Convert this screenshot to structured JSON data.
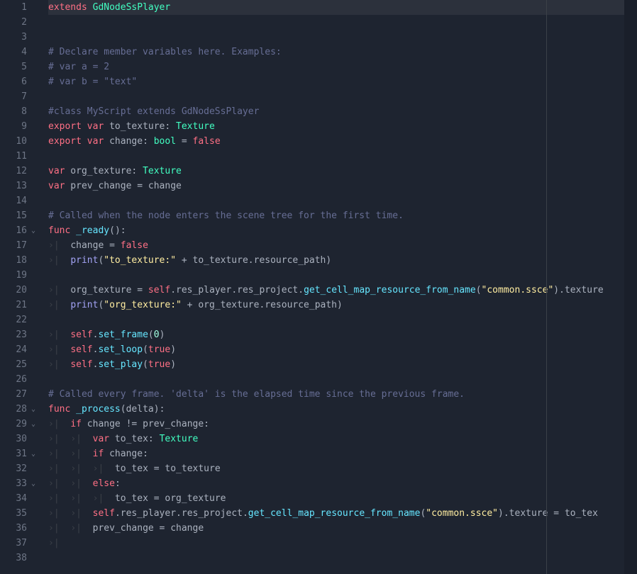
{
  "lines": [
    {
      "n": 1,
      "fold": "",
      "tokens": [
        [
          "keyword",
          "extends"
        ],
        [
          "ident",
          " "
        ],
        [
          "type",
          "GdNodeSsPlayer"
        ]
      ]
    },
    {
      "n": 2,
      "fold": "",
      "tokens": []
    },
    {
      "n": 3,
      "fold": "",
      "tokens": []
    },
    {
      "n": 4,
      "fold": "",
      "tokens": [
        [
          "comment",
          "# Declare member variables here. Examples:"
        ]
      ]
    },
    {
      "n": 5,
      "fold": "",
      "tokens": [
        [
          "comment",
          "# var a = 2"
        ]
      ]
    },
    {
      "n": 6,
      "fold": "",
      "tokens": [
        [
          "comment",
          "# var b = \"text\""
        ]
      ]
    },
    {
      "n": 7,
      "fold": "",
      "tokens": []
    },
    {
      "n": 8,
      "fold": "",
      "tokens": [
        [
          "comment",
          "#class MyScript extends GdNodeSsPlayer"
        ]
      ]
    },
    {
      "n": 9,
      "fold": "",
      "tokens": [
        [
          "keyword",
          "export"
        ],
        [
          "ident",
          " "
        ],
        [
          "keyword",
          "var"
        ],
        [
          "ident",
          " to_texture"
        ],
        [
          "punct",
          ": "
        ],
        [
          "type",
          "Texture"
        ]
      ]
    },
    {
      "n": 10,
      "fold": "",
      "tokens": [
        [
          "keyword",
          "export"
        ],
        [
          "ident",
          " "
        ],
        [
          "keyword",
          "var"
        ],
        [
          "ident",
          " change"
        ],
        [
          "punct",
          ": "
        ],
        [
          "type",
          "bool"
        ],
        [
          "punct",
          " = "
        ],
        [
          "bool",
          "false"
        ]
      ]
    },
    {
      "n": 11,
      "fold": "",
      "tokens": []
    },
    {
      "n": 12,
      "fold": "",
      "tokens": [
        [
          "keyword",
          "var"
        ],
        [
          "ident",
          " org_texture"
        ],
        [
          "punct",
          ": "
        ],
        [
          "type",
          "Texture"
        ]
      ]
    },
    {
      "n": 13,
      "fold": "",
      "tokens": [
        [
          "keyword",
          "var"
        ],
        [
          "ident",
          " prev_change "
        ],
        [
          "punct",
          "="
        ],
        [
          "ident",
          " change"
        ]
      ]
    },
    {
      "n": 14,
      "fold": "",
      "tokens": []
    },
    {
      "n": 15,
      "fold": "",
      "tokens": [
        [
          "comment",
          "# Called when the node enters the scene tree for the first time."
        ]
      ]
    },
    {
      "n": 16,
      "fold": "v",
      "tokens": [
        [
          "keyword",
          "func"
        ],
        [
          "ident",
          " "
        ],
        [
          "funcname",
          "_ready"
        ],
        [
          "punct",
          "("
        ],
        [
          "punct",
          ")"
        ],
        [
          "punct",
          ":"
        ]
      ]
    },
    {
      "n": 17,
      "fold": "",
      "indent": 1,
      "tokens": [
        [
          "ident",
          "change "
        ],
        [
          "punct",
          "="
        ],
        [
          "ident",
          " "
        ],
        [
          "bool",
          "false"
        ]
      ]
    },
    {
      "n": 18,
      "fold": "",
      "indent": 1,
      "tokens": [
        [
          "func",
          "print"
        ],
        [
          "punct",
          "("
        ],
        [
          "string",
          "\"to_texture:\""
        ],
        [
          "punct",
          " + "
        ],
        [
          "ident",
          "to_texture"
        ],
        [
          "punct",
          "."
        ],
        [
          "ident",
          "resource_path"
        ],
        [
          "punct",
          ")"
        ]
      ]
    },
    {
      "n": 19,
      "fold": "",
      "tokens": []
    },
    {
      "n": 20,
      "fold": "",
      "indent": 1,
      "tokens": [
        [
          "ident",
          "org_texture "
        ],
        [
          "punct",
          "="
        ],
        [
          "ident",
          " "
        ],
        [
          "keyword",
          "self"
        ],
        [
          "punct",
          "."
        ],
        [
          "ident",
          "res_player"
        ],
        [
          "punct",
          "."
        ],
        [
          "ident",
          "res_project"
        ],
        [
          "punct",
          "."
        ],
        [
          "method",
          "get_cell_map_resource_from_name"
        ],
        [
          "punct",
          "("
        ],
        [
          "string",
          "\"common.ssce\""
        ],
        [
          "punct",
          ")"
        ],
        [
          "punct",
          "."
        ],
        [
          "ident",
          "texture"
        ]
      ]
    },
    {
      "n": 21,
      "fold": "",
      "indent": 1,
      "tokens": [
        [
          "func",
          "print"
        ],
        [
          "punct",
          "("
        ],
        [
          "string",
          "\"org_texture:\""
        ],
        [
          "punct",
          " + "
        ],
        [
          "ident",
          "org_texture"
        ],
        [
          "punct",
          "."
        ],
        [
          "ident",
          "resource_path"
        ],
        [
          "punct",
          ")"
        ]
      ]
    },
    {
      "n": 22,
      "fold": "",
      "tokens": []
    },
    {
      "n": 23,
      "fold": "",
      "indent": 1,
      "tokens": [
        [
          "keyword",
          "self"
        ],
        [
          "punct",
          "."
        ],
        [
          "method",
          "set_frame"
        ],
        [
          "punct",
          "("
        ],
        [
          "number",
          "0"
        ],
        [
          "punct",
          ")"
        ]
      ]
    },
    {
      "n": 24,
      "fold": "",
      "indent": 1,
      "tokens": [
        [
          "keyword",
          "self"
        ],
        [
          "punct",
          "."
        ],
        [
          "method",
          "set_loop"
        ],
        [
          "punct",
          "("
        ],
        [
          "bool",
          "true"
        ],
        [
          "punct",
          ")"
        ]
      ]
    },
    {
      "n": 25,
      "fold": "",
      "indent": 1,
      "tokens": [
        [
          "keyword",
          "self"
        ],
        [
          "punct",
          "."
        ],
        [
          "method",
          "set_play"
        ],
        [
          "punct",
          "("
        ],
        [
          "bool",
          "true"
        ],
        [
          "punct",
          ")"
        ]
      ]
    },
    {
      "n": 26,
      "fold": "",
      "tokens": []
    },
    {
      "n": 27,
      "fold": "",
      "tokens": [
        [
          "comment",
          "# Called every frame. 'delta' is the elapsed time since the previous frame."
        ]
      ]
    },
    {
      "n": 28,
      "fold": "v",
      "tokens": [
        [
          "keyword",
          "func"
        ],
        [
          "ident",
          " "
        ],
        [
          "funcname",
          "_process"
        ],
        [
          "punct",
          "("
        ],
        [
          "ident",
          "delta"
        ],
        [
          "punct",
          ")"
        ],
        [
          "punct",
          ":"
        ]
      ]
    },
    {
      "n": 29,
      "fold": "v",
      "indent": 1,
      "tokens": [
        [
          "keyword",
          "if"
        ],
        [
          "ident",
          " change "
        ],
        [
          "punct",
          "!="
        ],
        [
          "ident",
          " prev_change"
        ],
        [
          "punct",
          ":"
        ]
      ]
    },
    {
      "n": 30,
      "fold": "",
      "indent": 2,
      "tokens": [
        [
          "keyword",
          "var"
        ],
        [
          "ident",
          " to_tex"
        ],
        [
          "punct",
          ": "
        ],
        [
          "type",
          "Texture"
        ]
      ]
    },
    {
      "n": 31,
      "fold": "v",
      "indent": 2,
      "tokens": [
        [
          "keyword",
          "if"
        ],
        [
          "ident",
          " change"
        ],
        [
          "punct",
          ":"
        ]
      ]
    },
    {
      "n": 32,
      "fold": "",
      "indent": 3,
      "tokens": [
        [
          "ident",
          "to_tex "
        ],
        [
          "punct",
          "="
        ],
        [
          "ident",
          " to_texture"
        ]
      ]
    },
    {
      "n": 33,
      "fold": "v",
      "indent": 2,
      "tokens": [
        [
          "keyword",
          "else"
        ],
        [
          "punct",
          ":"
        ]
      ]
    },
    {
      "n": 34,
      "fold": "",
      "indent": 3,
      "tokens": [
        [
          "ident",
          "to_tex "
        ],
        [
          "punct",
          "="
        ],
        [
          "ident",
          " org_texture"
        ]
      ]
    },
    {
      "n": 35,
      "fold": "",
      "indent": 2,
      "tokens": [
        [
          "keyword",
          "self"
        ],
        [
          "punct",
          "."
        ],
        [
          "ident",
          "res_player"
        ],
        [
          "punct",
          "."
        ],
        [
          "ident",
          "res_project"
        ],
        [
          "punct",
          "."
        ],
        [
          "method",
          "get_cell_map_resource_from_name"
        ],
        [
          "punct",
          "("
        ],
        [
          "string",
          "\"common.ssce\""
        ],
        [
          "punct",
          ")"
        ],
        [
          "punct",
          "."
        ],
        [
          "ident",
          "texture "
        ],
        [
          "punct",
          "="
        ],
        [
          "ident",
          " to_tex"
        ]
      ]
    },
    {
      "n": 36,
      "fold": "",
      "indent": 2,
      "tokens": [
        [
          "ident",
          "prev_change "
        ],
        [
          "punct",
          "="
        ],
        [
          "ident",
          " change"
        ]
      ]
    },
    {
      "n": 37,
      "fold": "",
      "indent": 1,
      "tokens": []
    },
    {
      "n": 38,
      "fold": "",
      "tokens": []
    }
  ],
  "active_line": 1,
  "indent_glyph": "›|  ",
  "fold_glyph": "⌄"
}
